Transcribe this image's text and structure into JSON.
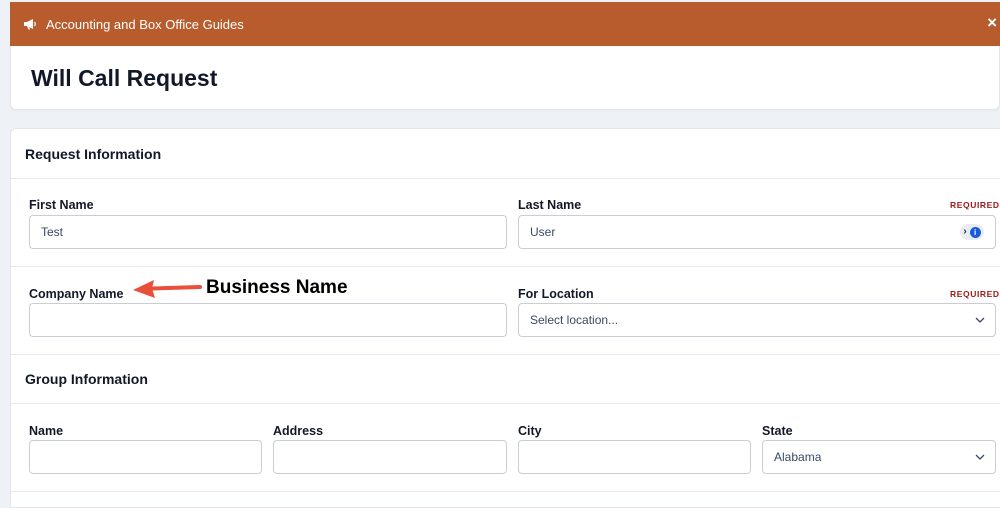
{
  "banner": {
    "title": "Accounting and Box Office Guides",
    "close_glyph": "×"
  },
  "page": {
    "title": "Will Call Request"
  },
  "request_section": {
    "title": "Request Information",
    "first_name": {
      "label": "First Name",
      "value": "Test"
    },
    "last_name": {
      "label": "Last Name",
      "required": "REQUIRED",
      "value": "User"
    },
    "company_name": {
      "label": "Company Name",
      "value": ""
    },
    "for_location": {
      "label": "For Location",
      "required": "REQUIRED",
      "selected": "Select location..."
    }
  },
  "annotation": {
    "text": "Business Name",
    "color": "#e8503a"
  },
  "group_section": {
    "title": "Group Information",
    "name": {
      "label": "Name",
      "value": ""
    },
    "address": {
      "label": "Address",
      "value": ""
    },
    "city": {
      "label": "City",
      "value": ""
    },
    "state": {
      "label": "State",
      "selected": "Alabama"
    }
  },
  "icons": {
    "banner": "megaphone-icon",
    "close": "close-icon",
    "select": "chevron-down-icon",
    "password_manager": "password-manager-icon"
  },
  "colors": {
    "banner_bg": "#b85c2e",
    "required": "#a11a1a",
    "input_text": "#3a4a63"
  }
}
